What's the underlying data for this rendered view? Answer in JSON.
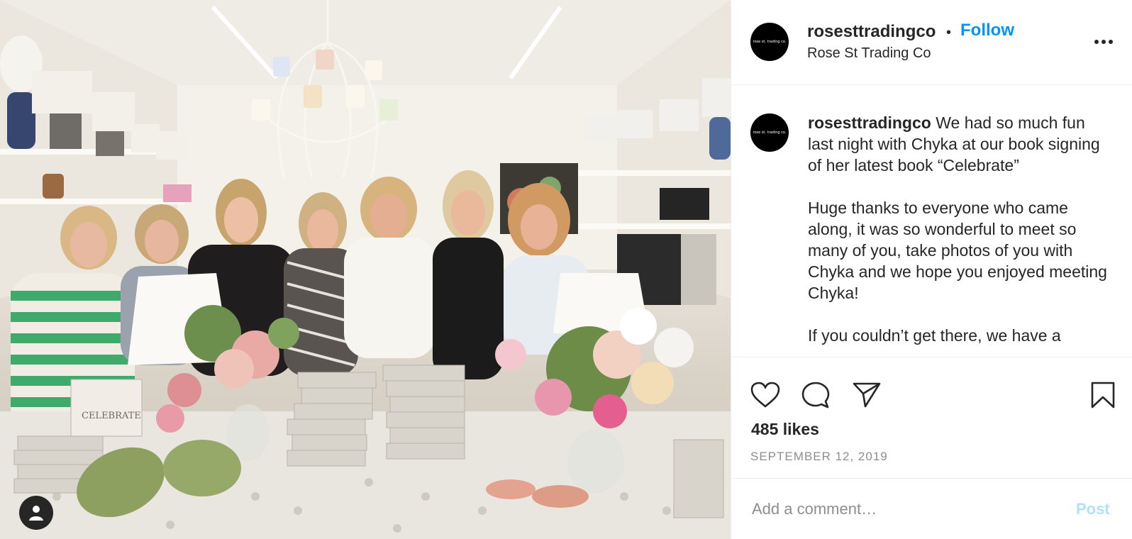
{
  "post": {
    "username": "rosesttradingco",
    "separator": "•",
    "follow_label": "Follow",
    "full_name": "Rose St Trading Co",
    "avatar_text": "rose st. trading co.",
    "more_icon": "more-horizontal-icon"
  },
  "caption": {
    "username": "rosesttradingco",
    "text": " We had so much fun last night with Chyka at our book signing of her latest book “Celebrate”\n\nHuge thanks to everyone who came along, it was so wonderful to meet so many of you, take photos of you with Chyka and we hope you enjoyed meeting Chyka!\n\nIf you couldn’t get there, we have a"
  },
  "photo": {
    "book_cover_text": "CELEBRATE",
    "user_tag_icon": "user-tag-icon"
  },
  "actions": {
    "like_icon": "heart-icon",
    "comment_icon": "comment-bubble-icon",
    "share_icon": "paper-plane-icon",
    "save_icon": "bookmark-icon"
  },
  "likes_text": "485 likes",
  "date_text": "SEPTEMBER 12, 2019",
  "comment": {
    "placeholder": "Add a comment…",
    "post_label": "Post"
  },
  "colors": {
    "accent": "#0095f6",
    "post_disabled": "#b2dffc",
    "text": "#262626",
    "muted": "#8e8e8e"
  }
}
